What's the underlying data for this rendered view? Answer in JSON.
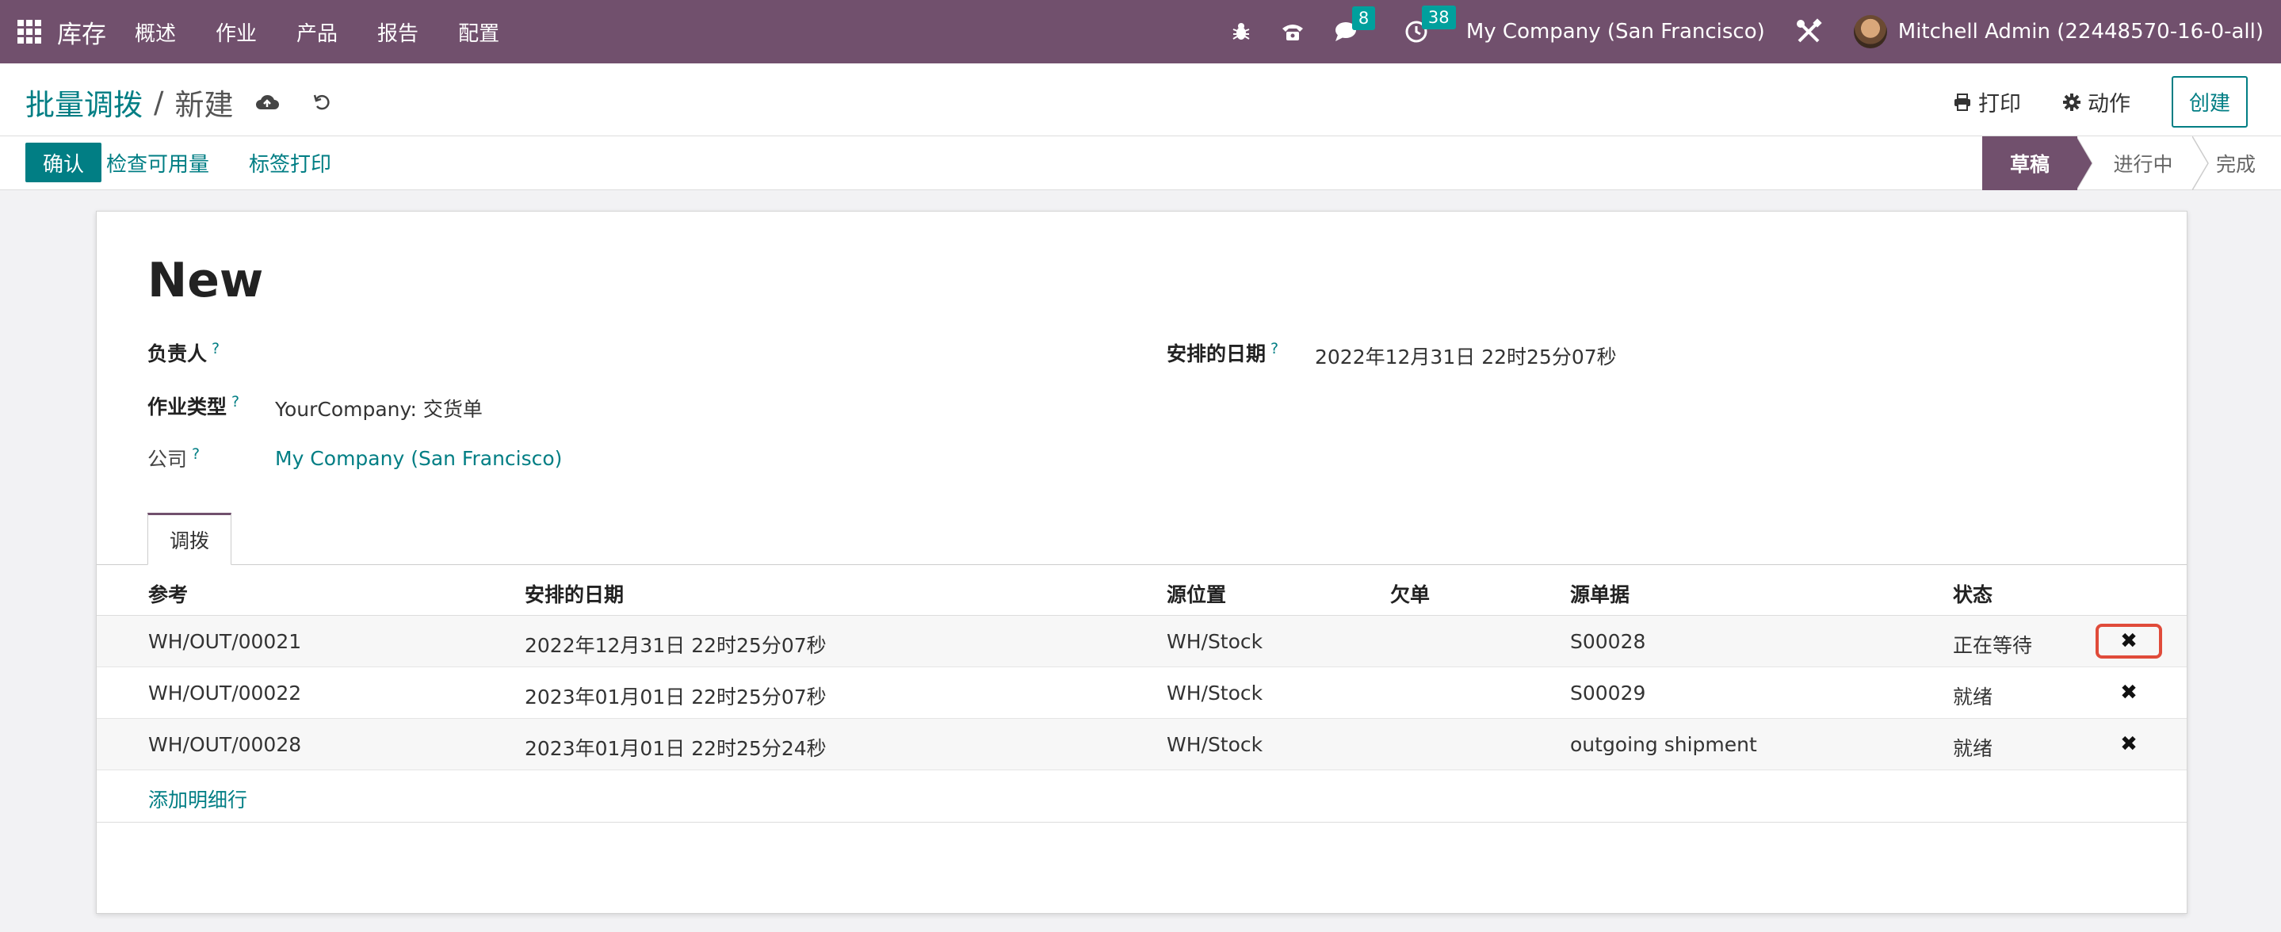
{
  "navbar": {
    "app_name": "库存",
    "menu": [
      "概述",
      "作业",
      "产品",
      "报告",
      "配置"
    ],
    "messages_count": "8",
    "activities_count": "38",
    "company": "My Company (San Francisco)",
    "user": "Mitchell Admin (22448570-16-0-all)"
  },
  "breadcrumb": {
    "parent": "批量调拨",
    "current": "新建"
  },
  "actions": {
    "print": "打印",
    "action": "动作",
    "create": "创建"
  },
  "buttons": {
    "confirm": "确认",
    "check_availability": "检查可用量",
    "print_labels": "标签打印"
  },
  "statusbar": [
    "草稿",
    "进行中",
    "完成"
  ],
  "record": {
    "title": "New",
    "responsible_label": "负责人",
    "operation_type_label": "作业类型",
    "operation_type_value": "YourCompany: 交货单",
    "company_label": "公司",
    "company_value": "My Company (San Francisco)",
    "scheduled_date_label": "安排的日期",
    "scheduled_date_value": "2022年12月31日 22时25分07秒",
    "help_mark": "?"
  },
  "tab": {
    "label": "调拨"
  },
  "table": {
    "headers": [
      "参考",
      "安排的日期",
      "源位置",
      "欠单",
      "源单据",
      "状态"
    ],
    "rows": [
      {
        "ref": "WH/OUT/00021",
        "date": "2022年12月31日 22时25分07秒",
        "source": "WH/Stock",
        "backorder": "",
        "origin": "S00028",
        "state": "正在等待"
      },
      {
        "ref": "WH/OUT/00022",
        "date": "2023年01月01日 22时25分07秒",
        "source": "WH/Stock",
        "backorder": "",
        "origin": "S00029",
        "state": "就绪"
      },
      {
        "ref": "WH/OUT/00028",
        "date": "2023年01月01日 22时25分24秒",
        "source": "WH/Stock",
        "backorder": "",
        "origin": "outgoing shipment",
        "state": "就绪"
      }
    ],
    "add_line": "添加明细行",
    "delete_glyph": "✖"
  },
  "colors": {
    "brand": "#71506d",
    "accent": "#017e84",
    "highlight": "#e04b3a"
  }
}
